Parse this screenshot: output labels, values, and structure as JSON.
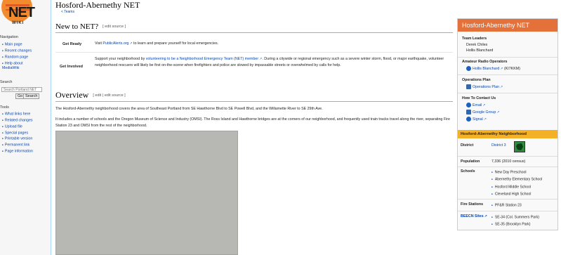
{
  "site": {
    "logo_text": "NET",
    "logo_sub": "WIKI"
  },
  "sidebar": {
    "nav_heading": "Navigation",
    "nav_items": [
      "Main page",
      "Recent changes",
      "Random page",
      "Help about MediaWiki"
    ],
    "search_heading": "Search",
    "search_placeholder": "Search Portland NET",
    "go_label": "Go",
    "search_label": "Search",
    "tools_heading": "Tools",
    "tool_items": [
      "What links here",
      "Related changes",
      "Upload file",
      "Special pages",
      "Printable version",
      "Permanent link",
      "Page information"
    ]
  },
  "page": {
    "title": "Hosford-Abernethy NET",
    "breadcrumb": "< Teams"
  },
  "new_to_net": {
    "heading": "New to NET?",
    "edit_link": "[ edit source ]",
    "get_ready_label": "Get Ready",
    "get_ready_pre": "Visit ",
    "get_ready_link": "PublicAlerts.org",
    "get_ready_post": " to learn and prepare yourself for local emergencies.",
    "get_involved_label": "Get Involved",
    "get_involved_pre": "Support your neighborhood by ",
    "get_involved_link": "volunteering to be a Neighborhood Emergency Team (NET) member",
    "get_involved_post": ". During a citywide or regional emergency such as a severe winter storm, flood, or major earthquake, volunteer neighborhood rescuers will likely be first on-the-scene when firefighters and police are slowed by impassable streets or overwhelmed by calls for help."
  },
  "overview": {
    "heading": "Overview",
    "edit_link": "[ edit | edit source ]",
    "para1": "The Hosford-Abernethy neighborhood covers the area of Southeast Portland from SE Hawthorne Blvd to SE Powell Blvd, and the Willamette River to SE 29th Ave.",
    "para2": "It includes a number of schools and the Oregon Museum of Science and Industry (OMSI). The Ross Island and Hawthorne bridges are at the corners of our neighborhood, and frequently used train tracks travel along the river, separating Fire Station 23 and OMSI from the rest of the neighborhood."
  },
  "infobox": {
    "title": "Hosford-Abernethy NET",
    "team_leaders_h": "Team Leaders",
    "team_leaders": [
      "Derek Chiles",
      "Hollis Blanchard"
    ],
    "ham_h": "Amateur Radio Operators",
    "ham_link": "Hollis Blanchard",
    "ham_call": " (KI7KKM)",
    "ops_h": "Operations Plan",
    "ops_link": "Operations Plan",
    "contact_h": "How To Contact Us",
    "contact_links": [
      "Email",
      "Google Group",
      "Signal"
    ]
  },
  "neighborhood": {
    "title": "Hosford-Abernethy Neighborhood",
    "district_k": "District",
    "district_v": "District 3",
    "population_k": "Population",
    "population_v": "7,336 (2010 census)",
    "schools_k": "Schools",
    "schools": [
      "New Day Preschool",
      "Abernethy Elementary School",
      "Hosford Middle School",
      "Cleveland High School"
    ],
    "fire_k": "Fire Stations",
    "fire": [
      "PF&R Station 23"
    ],
    "beecn_k": "BEECN Sites",
    "beecn": [
      "SE-34 (Col. Summers Park)",
      "SE-35 (Brooklyn Park)"
    ]
  },
  "colors": {
    "accent_orange": "#e4703a",
    "neighborhood_yellow": "#f4b128",
    "link_blue": "#0645ad",
    "district_green": "#2e8b3c"
  }
}
